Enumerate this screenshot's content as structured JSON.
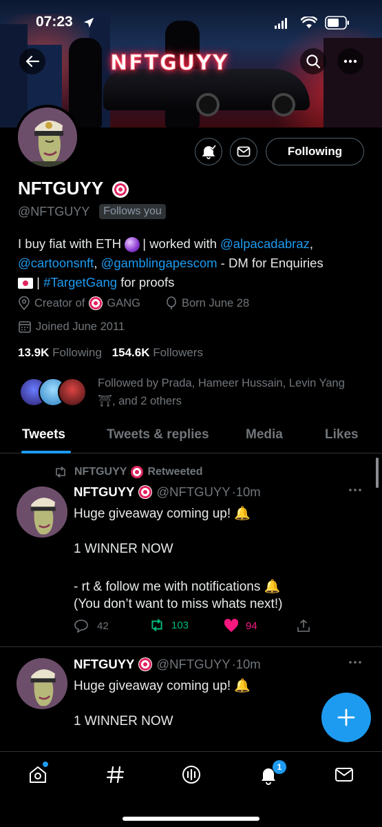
{
  "status": {
    "time": "07:23"
  },
  "banner": {
    "title": "NFTGUYY"
  },
  "profile": {
    "name": "NFTGUYY",
    "handle": "@NFTGUYY",
    "follows_you": "Follows you",
    "follow_button": "Following",
    "bio": {
      "p1": "I buy fiat with ETH ",
      "p2": "| worked with ",
      "link1": "@alpacadabraz",
      "comma1": ",",
      "link2": "@cartoonsnft",
      "comma2": ", ",
      "link3": "@gamblingapescom",
      "p3": " - DM for Enquiries",
      "p4": " | ",
      "link4": "#TargetGang",
      "p5": " for proofs"
    },
    "location_prefix": "Creator of",
    "location_suffix": "GANG",
    "birthday": "Born June 28",
    "joined": "Joined June 2011",
    "following_count": "13.9K",
    "following_label": "Following",
    "followers_count": "154.6K",
    "followers_label": "Followers",
    "followed_by": "Followed by Prada, Hameer Hussain, Levin Yang ⛩, and 2 others"
  },
  "tabs": [
    "Tweets",
    "Tweets & replies",
    "Media",
    "Likes"
  ],
  "tweets": [
    {
      "retweet_by": "NFTGUYY",
      "retweet_label": "Retweeted",
      "name": "NFTGUYY",
      "handle": "@NFTGUYY",
      "time": "·10m",
      "lines": [
        "Huge giveaway coming up! 🔔",
        "1 WINNER NOW",
        "- rt & follow me with notifications 🔔",
        "(You don’t want to miss whats next!)"
      ],
      "replies": "42",
      "retweets": "103",
      "likes": "94"
    },
    {
      "name": "NFTGUYY",
      "handle": "@NFTGUYY",
      "time": "·10m",
      "lines": [
        "Huge giveaway coming up! 🔔",
        "1 WINNER NOW"
      ]
    }
  ],
  "nav": {
    "notifications_badge": "1"
  },
  "colors": {
    "accent": "#1d9bf0",
    "like": "#f91880",
    "retweet": "#00ba7c"
  }
}
